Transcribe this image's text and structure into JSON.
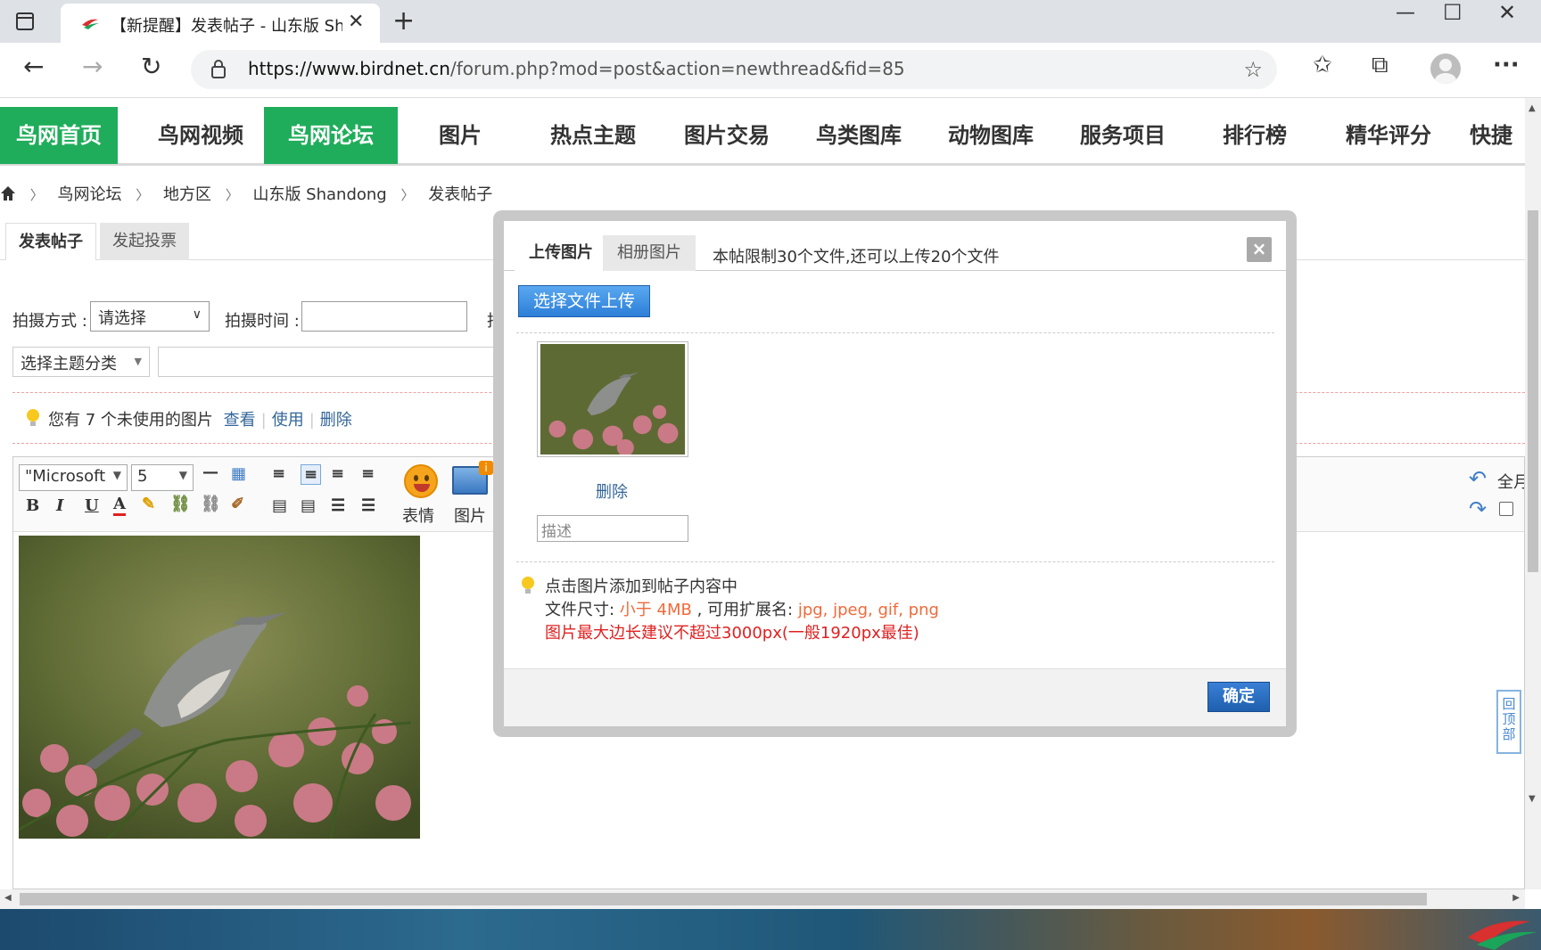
{
  "browser": {
    "tab_title": "【新提醒】发表帖子 - 山东版 Shandong",
    "url_host": "https://www.birdnet.cn",
    "url_path": "/forum.php?mod=post&action=newthread&fid=85"
  },
  "site_nav": [
    {
      "label": "鸟网首页",
      "active": true
    },
    {
      "label": "鸟网视频",
      "active": false
    },
    {
      "label": "鸟网论坛",
      "active": true
    },
    {
      "label": "图片",
      "active": false
    },
    {
      "label": "热点主题",
      "active": false
    },
    {
      "label": "图片交易",
      "active": false
    },
    {
      "label": "鸟类图库",
      "active": false
    },
    {
      "label": "动物图库",
      "active": false
    },
    {
      "label": "服务项目",
      "active": false
    },
    {
      "label": "排行榜",
      "active": false
    },
    {
      "label": "精华评分",
      "active": false
    },
    {
      "label": "快捷",
      "active": false
    }
  ],
  "breadcrumb": [
    "鸟网论坛",
    "地方区",
    "山东版 Shandong",
    "发表帖子"
  ],
  "subtabs": [
    "发表帖子",
    "发起投票"
  ],
  "form": {
    "shoot_method_label": "拍摄方式 :",
    "shoot_method_value": "请选择",
    "shoot_time_label": "拍摄时间 :",
    "third_label": "拍",
    "category_value": "选择主题分类"
  },
  "notice": {
    "text": "您有 7 个未使用的图片",
    "view": "查看",
    "use": "使用",
    "delete": "删除"
  },
  "editor": {
    "font": "\"Microsoft",
    "size": "5",
    "emoji_label": "表情",
    "image_label": "图片",
    "right_label_1": "全月",
    "right_label_2": ""
  },
  "modal": {
    "tab_upload": "上传图片",
    "tab_album": "相册图片",
    "limit_text": "本帖限制30个文件,还可以上传20个文件",
    "close": "×",
    "upload_button": "选择文件上传",
    "delete_link": "删除",
    "desc_placeholder": "描述",
    "tip_1": "点击图片添加到帖子内容中",
    "tip_2_prefix": "文件尺寸: ",
    "tip_2_size": "小于 4MB",
    "tip_2_mid": " , 可用扩展名: ",
    "tip_2_ext": "jpg, jpeg, gif, png",
    "tip_3": "图片最大边长建议不超过3000px(一般1920px最佳)",
    "ok_button": "确定"
  },
  "back_to_top": "回顶部",
  "colors": {
    "nav_active": "#20ad5b",
    "link": "#336699",
    "orange": "#f06a3a",
    "red": "#e02020",
    "button_blue": "#2d7fd8"
  }
}
